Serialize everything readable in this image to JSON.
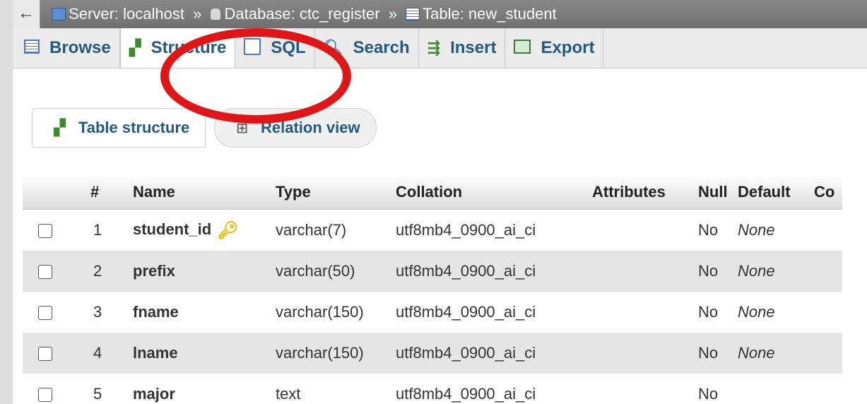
{
  "breadcrumb": {
    "back_glyph": "←",
    "server": "Server: localhost",
    "database": "Database: ctc_register",
    "table": "Table: new_student",
    "separator": "»"
  },
  "tabs": [
    {
      "label": "Browse",
      "icon": "browse-icon"
    },
    {
      "label": "Structure",
      "icon": "structure-icon",
      "active": true
    },
    {
      "label": "SQL",
      "icon": "sql-icon"
    },
    {
      "label": "Search",
      "icon": "search-icon"
    },
    {
      "label": "Insert",
      "icon": "insert-icon"
    },
    {
      "label": "Export",
      "icon": "export-icon"
    }
  ],
  "subtabs": [
    {
      "label": "Table structure",
      "icon": "structure-icon"
    },
    {
      "label": "Relation view",
      "icon": "relation-icon"
    }
  ],
  "columns_table": {
    "headers": [
      "#",
      "Name",
      "Type",
      "Collation",
      "Attributes",
      "Null",
      "Default",
      "Co"
    ],
    "rows": [
      {
        "num": "1",
        "name": "student_id",
        "type": "varchar(7)",
        "collation": "utf8mb4_0900_ai_ci",
        "attributes": "",
        "null": "No",
        "default": "None",
        "primary_key": true
      },
      {
        "num": "2",
        "name": "prefix",
        "type": "varchar(50)",
        "collation": "utf8mb4_0900_ai_ci",
        "attributes": "",
        "null": "No",
        "default": "None"
      },
      {
        "num": "3",
        "name": "fname",
        "type": "varchar(150)",
        "collation": "utf8mb4_0900_ai_ci",
        "attributes": "",
        "null": "No",
        "default": "None"
      },
      {
        "num": "4",
        "name": "lname",
        "type": "varchar(150)",
        "collation": "utf8mb4_0900_ai_ci",
        "attributes": "",
        "null": "No",
        "default": "None"
      },
      {
        "num": "5",
        "name": "major",
        "type": "text",
        "collation": "utf8mb4_0900_ai_ci",
        "attributes": "",
        "null": "No",
        "default": ""
      }
    ]
  },
  "colors": {
    "link": "#235a81",
    "annotation": "#e01515",
    "row_alt": "#e5e5e5"
  }
}
